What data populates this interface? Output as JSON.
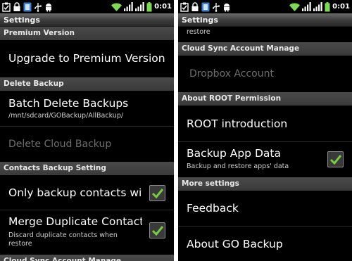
{
  "status_bar": {
    "time": "0:01",
    "left_icons": [
      "clipboard-check-icon",
      "lock-icon",
      "app-icon",
      "usb-icon",
      "android-icon"
    ],
    "right_icons": [
      "wifi-icon",
      "signal-icon",
      "signal-icon",
      "battery-icon"
    ]
  },
  "colors": {
    "check": "#79c942",
    "category_bg": "#3f3f3f",
    "title_bg": "#4a4a4a"
  },
  "left": {
    "title": "Settings",
    "sections": {
      "premium": "Premium Version",
      "delete": "Delete Backup",
      "contacts": "Contacts Backup Setting",
      "cloud_partial": "Cloud Sync Account Manage"
    },
    "items": {
      "upgrade": "Upgrade to Premium Version",
      "batch_delete": "Batch Delete Backups",
      "batch_delete_summary": "/mnt/sdcard/GOBackup/AllBackup/",
      "delete_cloud": "Delete Cloud Backup",
      "only_contacts": "Only backup contacts wit",
      "merge": "Merge Duplicate Contact",
      "merge_summary": "Discard duplicate contacts when restore"
    }
  },
  "right": {
    "title": "Settings",
    "partial_summary": "restore",
    "sections": {
      "cloud": "Cloud Sync Account Manage",
      "root": "About ROOT Permission",
      "more": "More settings"
    },
    "items": {
      "dropbox": "Dropbox Account",
      "root_intro": "ROOT introduction",
      "backup_app_data": "Backup App Data",
      "backup_app_data_summary": "Backup and restore apps' data",
      "feedback": "Feedback",
      "about": "About GO Backup"
    }
  }
}
